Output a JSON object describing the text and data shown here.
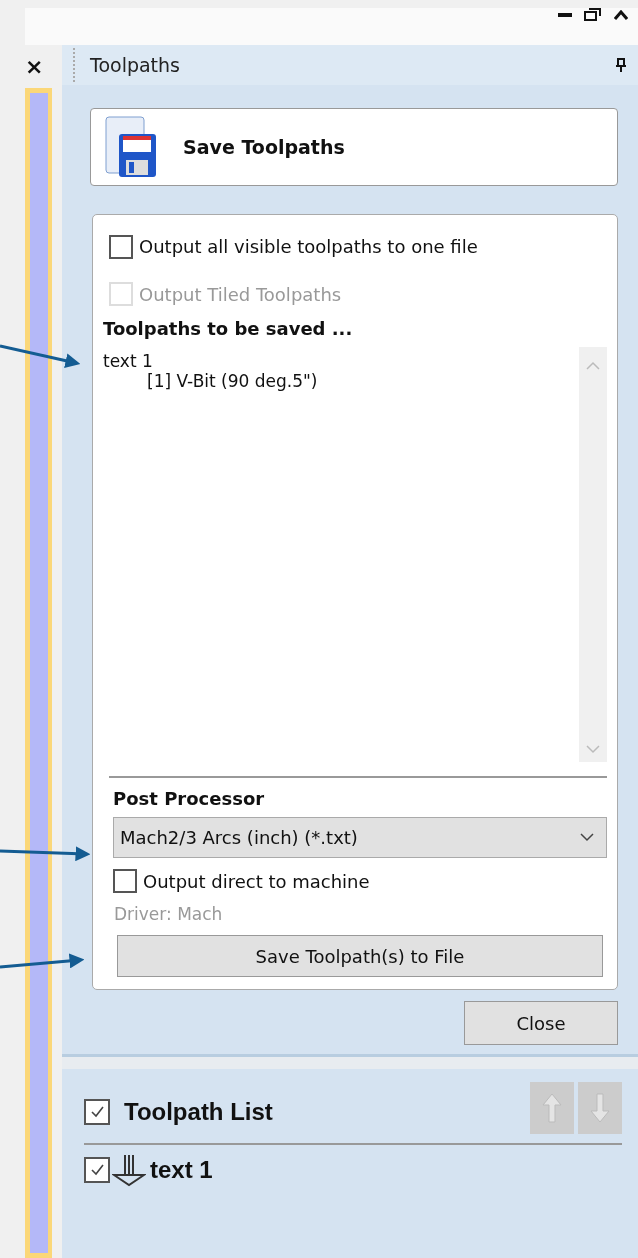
{
  "left_pane": {
    "close_glyph": "×"
  },
  "panel": {
    "title": "Toolpaths"
  },
  "save_header": {
    "label": "Save Toolpaths"
  },
  "options": [
    {
      "label": "Output all visible toolpaths to one file",
      "checked": false,
      "disabled": false
    },
    {
      "label": "Output Tiled Toolpaths",
      "checked": false,
      "disabled": true
    }
  ],
  "saved_heading": "Toolpaths to be saved ...",
  "saved_list": [
    {
      "name": "text 1",
      "children": [
        {
          "name": "[1] V-Bit (90 deg.5\")"
        }
      ]
    }
  ],
  "post_processor": {
    "heading": "Post Processor",
    "selected": "Mach2/3 Arcs (inch) (*.txt)",
    "direct_output": {
      "label": "Output direct to machine",
      "checked": false
    },
    "driver": "Driver: Mach",
    "save_button": "Save Toolpath(s) to File"
  },
  "close_button": "Close",
  "toolpath_list": {
    "title": "Toolpath List",
    "checked": true,
    "move_buttons": [
      {
        "kind": "up",
        "disabled": true
      },
      {
        "kind": "down",
        "disabled": true
      }
    ],
    "items": [
      {
        "name": "text 1",
        "checked": true
      }
    ]
  }
}
